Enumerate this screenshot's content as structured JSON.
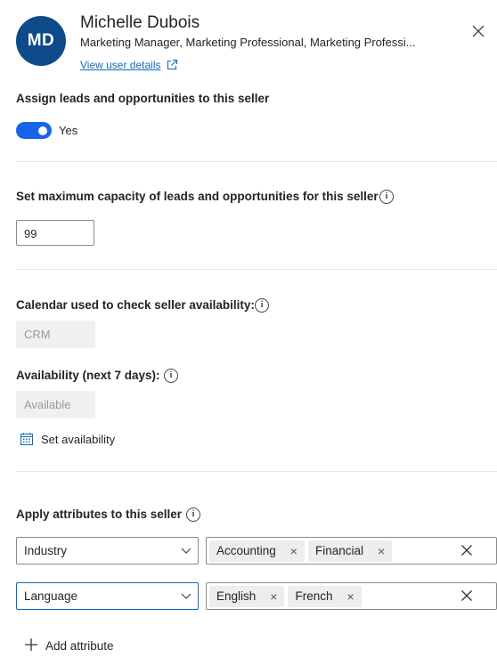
{
  "user": {
    "initials": "MD",
    "name": "Michelle Dubois",
    "roles": "Marketing Manager, Marketing Professional, Marketing Professi...",
    "view_details": "View user details"
  },
  "assign": {
    "label": "Assign leads and opportunities to this seller",
    "toggle_on": true,
    "toggle_text": "Yes"
  },
  "capacity": {
    "label": "Set maximum capacity of leads and opportunities for this seller",
    "value": "99"
  },
  "calendar": {
    "label": "Calendar used to check seller availability:",
    "value": "CRM"
  },
  "availability": {
    "label": "Availability (next 7 days):",
    "value": "Available",
    "set_link": "Set availability"
  },
  "attributes": {
    "label": "Apply attributes to this seller",
    "rows": [
      {
        "select": "Industry",
        "tags": [
          "Accounting",
          "Financial"
        ]
      },
      {
        "select": "Language",
        "tags": [
          "English",
          "French"
        ]
      }
    ],
    "add_label": "Add attribute"
  },
  "icons": {
    "close": "close-icon",
    "external": "external-link-icon",
    "info": "info-icon",
    "calendar": "calendar-icon",
    "chevron": "chevron-down-icon",
    "plus": "plus-icon"
  },
  "colors": {
    "avatar": "#0f4a8a",
    "toggle": "#1764e8",
    "link": "#0f6cbd"
  }
}
